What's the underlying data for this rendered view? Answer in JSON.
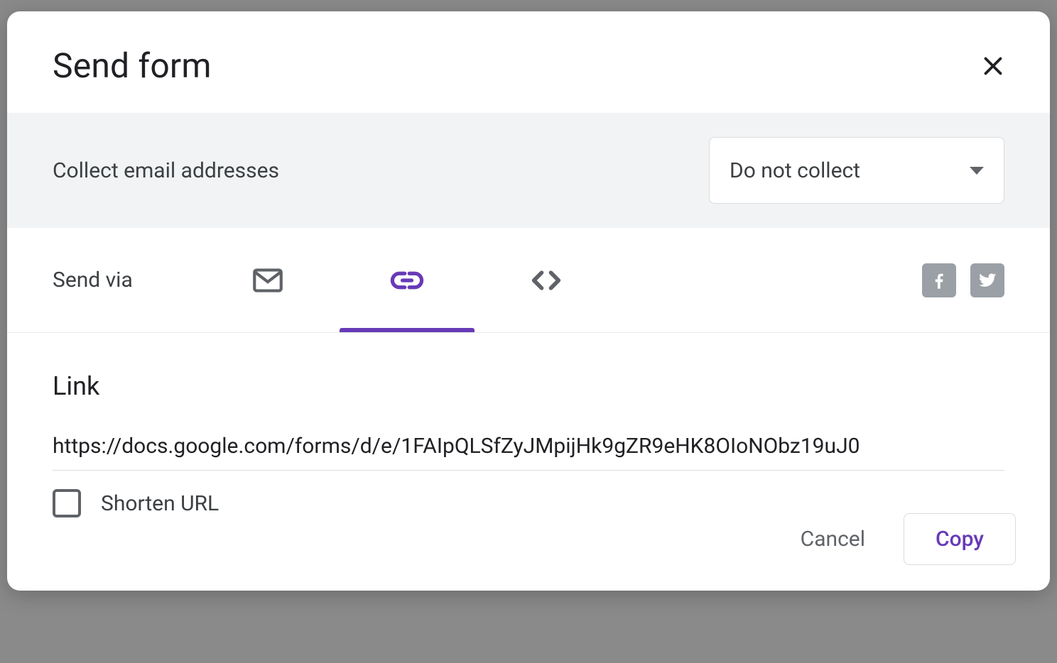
{
  "dialog": {
    "title": "Send form",
    "collect": {
      "label": "Collect email addresses",
      "selected": "Do not collect"
    },
    "send_via_label": "Send via",
    "tabs": {
      "email": "Email",
      "link": "Link",
      "embed": "Embed HTML",
      "active": "link"
    },
    "social": {
      "facebook": "Share on Facebook",
      "twitter": "Share on Twitter"
    },
    "link_panel": {
      "heading": "Link",
      "url": "https://docs.google.com/forms/d/e/1FAIpQLSfZyJMpijHk9gZR9eHK8OIoNObz19uJ0",
      "shorten_label": "Shorten URL",
      "shorten_checked": false
    },
    "actions": {
      "cancel": "Cancel",
      "copy": "Copy"
    }
  },
  "colors": {
    "accent": "#673ab7"
  }
}
